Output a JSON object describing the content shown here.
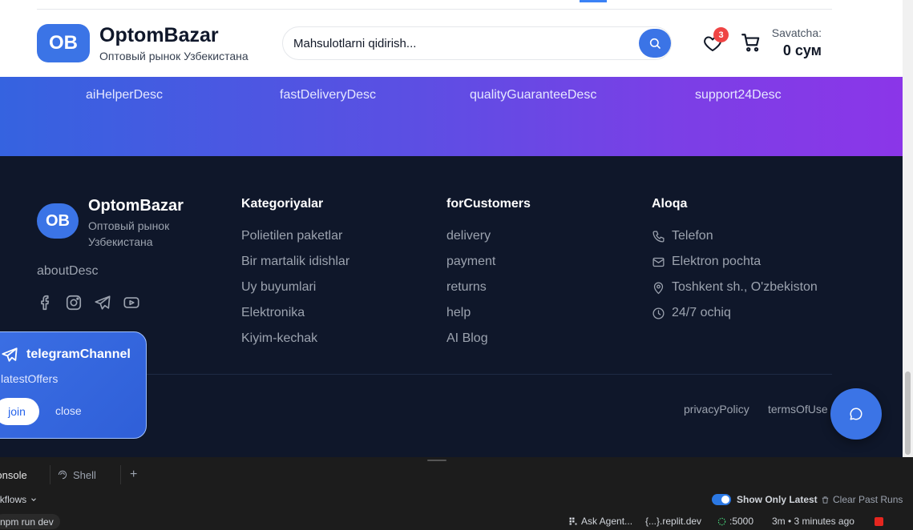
{
  "header": {
    "logo_initials": "OB",
    "brand_name": "OptomBazar",
    "brand_subtitle": "Оптовый рынок Узбекистана",
    "search_placeholder": "Mahsulotlarni qidirish...",
    "wishlist_count": "3",
    "cart_label": "Savatcha:",
    "cart_total": "0 сум"
  },
  "features": [
    "aiHelperDesc",
    "fastDeliveryDesc",
    "qualityGuaranteeDesc",
    "support24Desc"
  ],
  "footer": {
    "logo_initials": "OB",
    "brand_name": "OptomBazar",
    "brand_subtitle": "Оптовый рынок Узбекистана",
    "about": "aboutDesc",
    "social_icons": [
      "facebook-icon",
      "instagram-icon",
      "telegram-icon",
      "youtube-icon"
    ],
    "categories": {
      "title": "Kategoriyalar",
      "items": [
        "Polietilen paketlar",
        "Bir martalik idishlar",
        "Uy buyumlari",
        "Elektronika",
        "Kiyim-kechak"
      ]
    },
    "customers": {
      "title": "forCustomers",
      "items": [
        "delivery",
        "payment",
        "returns",
        "help",
        "AI Blog"
      ]
    },
    "contact": {
      "title": "Aloqa",
      "items": [
        {
          "icon": "phone-icon",
          "text": "Telefon"
        },
        {
          "icon": "mail-icon",
          "text": "Elektron pochta"
        },
        {
          "icon": "location-icon",
          "text": "Toshkent sh., O'zbekiston"
        },
        {
          "icon": "clock-icon",
          "text": "24/7 ochiq"
        }
      ]
    },
    "legal": {
      "privacy": "privacyPolicy",
      "terms": "termsOfUse"
    }
  },
  "telegram_popup": {
    "title": "telegramChannel",
    "description": "latestOffers",
    "join_label": "join",
    "close_label": "close"
  },
  "ide": {
    "tabs": [
      {
        "label": "Console",
        "active": true
      },
      {
        "label": "Shell",
        "active": false
      }
    ],
    "add_tab": "+",
    "workflows_label": "Workflows",
    "show_only_latest": "Show Only Latest",
    "clear_past_runs": "Clear Past Runs",
    "run_command": "npm run dev",
    "ask_agent": "Ask Agent...",
    "domain": "{...}.replit.dev",
    "port": ":5000",
    "uptime": "3m • 3 minutes ago"
  },
  "colors": {
    "brand_blue": "#3b74e6",
    "footer_bg": "#0f172a",
    "badge_red": "#ef4444",
    "gradient_start": "#3563e0",
    "gradient_end": "#8b36e8"
  }
}
